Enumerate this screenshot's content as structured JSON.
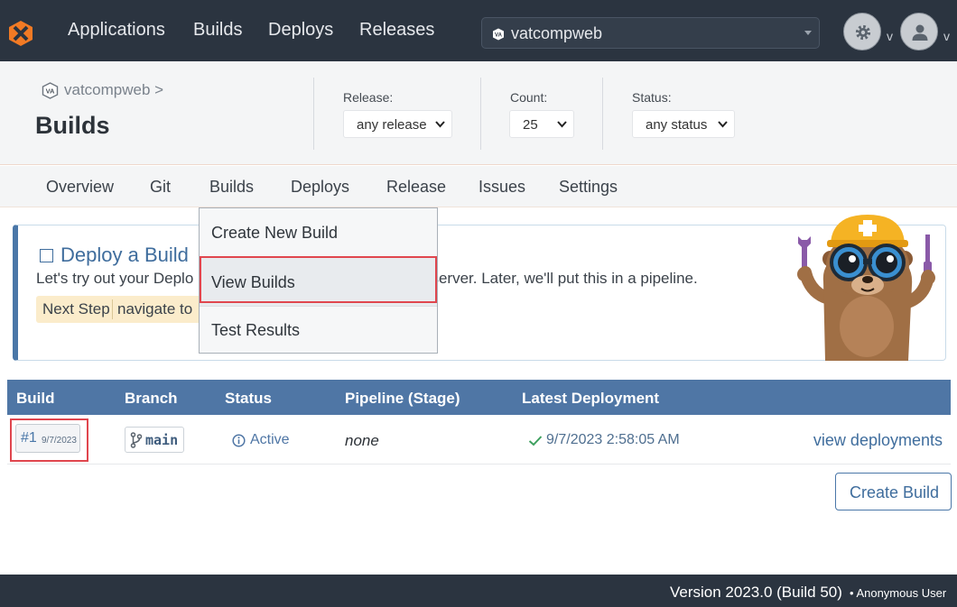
{
  "topnav": {
    "items": [
      "Applications",
      "Builds",
      "Deploys",
      "Releases"
    ],
    "app_selector": {
      "badge": "VA",
      "value": "vatcompweb"
    },
    "settings_caret": "v",
    "user_caret": "v"
  },
  "header": {
    "breadcrumb": "vatcompweb >",
    "breadcrumb_badge": "VA",
    "title": "Builds",
    "filters": [
      {
        "label": "Release:",
        "value": "any release"
      },
      {
        "label": "Count:",
        "value": "25"
      },
      {
        "label": "Status:",
        "value": "any status"
      }
    ]
  },
  "subnav": {
    "items": [
      "Overview",
      "Git",
      "Builds",
      "Deploys",
      "Release",
      "Issues",
      "Settings"
    ]
  },
  "dropdown": {
    "items": [
      "Create New Build",
      "View Builds",
      "Test Results"
    ],
    "highlighted": "View Builds"
  },
  "card": {
    "title": "Deploy a Build",
    "text_before": "Let's try out your Deplo",
    "text_after": "a server. Later, we'll put this in a pipeline.",
    "next_step": "Next Step",
    "navigate": "navigate to"
  },
  "table": {
    "headers": [
      "Build",
      "Branch",
      "Status",
      "Pipeline (Stage)",
      "Latest Deployment"
    ],
    "rows": [
      {
        "build_number": "#1",
        "build_date": "9/7/2023",
        "branch": "main",
        "status": "Active",
        "pipeline": "none",
        "latest_deployment": "9/7/2023 2:58:05 AM",
        "action": "view deployments"
      }
    ]
  },
  "create_button": "Create Build",
  "footer": {
    "version": "Version 2023.0 (Build 50)",
    "user": "• Anonymous User"
  },
  "colors": {
    "nav_bg": "#2b3440",
    "accent": "#4a77a8",
    "table_header": "#4f76a5",
    "highlight": "#e0464e",
    "next_step_bg": "#fbeccb",
    "logo_orange": "#f27a24"
  }
}
